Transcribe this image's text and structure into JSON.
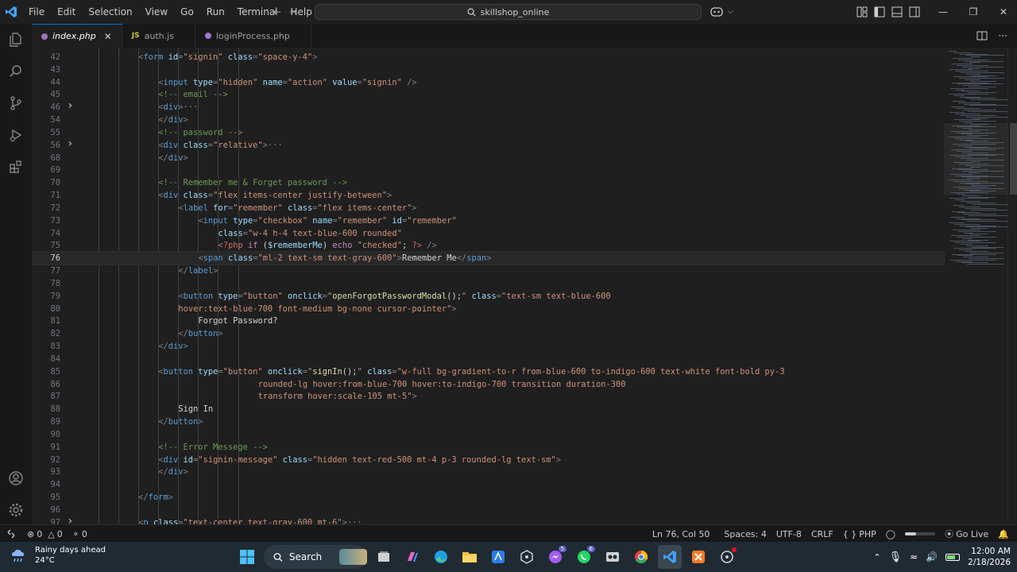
{
  "menu": [
    "File",
    "Edit",
    "Selection",
    "View",
    "Go",
    "Run",
    "Terminal",
    "Help"
  ],
  "search_box": "skillshop_online",
  "tabs": [
    {
      "label": "index.php",
      "icon": "php-icon",
      "active": true
    },
    {
      "label": "auth.js",
      "icon": "js-icon",
      "active": false
    },
    {
      "label": "loginProcess.php",
      "icon": "php-icon",
      "active": false
    }
  ],
  "tab_js_mark": "JS",
  "code_lines": [
    {
      "n": "42",
      "indent": 2,
      "tokens": [
        [
          "t",
          "<"
        ],
        [
          "n",
          "form"
        ],
        [
          "a",
          " id"
        ],
        [
          "t",
          "="
        ],
        [
          "s",
          "\"signin\""
        ],
        [
          "a",
          " class"
        ],
        [
          "t",
          "="
        ],
        [
          "s",
          "\"space-y-4\""
        ],
        [
          "t",
          ">"
        ]
      ]
    },
    {
      "n": "43",
      "indent": 0,
      "tokens": []
    },
    {
      "n": "44",
      "indent": 3,
      "tokens": [
        [
          "t",
          "<"
        ],
        [
          "n",
          "input"
        ],
        [
          "a",
          " type"
        ],
        [
          "t",
          "="
        ],
        [
          "s",
          "\"hidden\""
        ],
        [
          "a",
          " name"
        ],
        [
          "t",
          "="
        ],
        [
          "s",
          "\"action\""
        ],
        [
          "a",
          " value"
        ],
        [
          "t",
          "="
        ],
        [
          "s",
          "\"signin\""
        ],
        [
          "t",
          " />"
        ]
      ]
    },
    {
      "n": "45",
      "indent": 3,
      "tokens": [
        [
          "c",
          "<!-- email -->"
        ]
      ]
    },
    {
      "n": "46",
      "indent": 3,
      "fold": true,
      "tokens": [
        [
          "t",
          "<"
        ],
        [
          "n",
          "div"
        ],
        [
          "t",
          ">"
        ],
        [
          "e",
          "···"
        ]
      ]
    },
    {
      "n": "54",
      "indent": 3,
      "tokens": [
        [
          "t",
          "</"
        ],
        [
          "n",
          "div"
        ],
        [
          "t",
          ">"
        ]
      ]
    },
    {
      "n": "55",
      "indent": 3,
      "tokens": [
        [
          "c",
          "<!-- password -->"
        ]
      ]
    },
    {
      "n": "56",
      "indent": 3,
      "fold": true,
      "tokens": [
        [
          "t",
          "<"
        ],
        [
          "n",
          "div"
        ],
        [
          "a",
          " class"
        ],
        [
          "t",
          "="
        ],
        [
          "s",
          "\"relative\""
        ],
        [
          "t",
          ">"
        ],
        [
          "e",
          "···"
        ]
      ]
    },
    {
      "n": "68",
      "indent": 3,
      "tokens": [
        [
          "t",
          "</"
        ],
        [
          "n",
          "div"
        ],
        [
          "t",
          ">"
        ]
      ]
    },
    {
      "n": "69",
      "indent": 0,
      "tokens": []
    },
    {
      "n": "70",
      "indent": 3,
      "tokens": [
        [
          "c",
          "<!-- Remember me & Forget password -->"
        ]
      ]
    },
    {
      "n": "71",
      "indent": 3,
      "tokens": [
        [
          "t",
          "<"
        ],
        [
          "n",
          "div"
        ],
        [
          "a",
          " class"
        ],
        [
          "t",
          "="
        ],
        [
          "s",
          "\"flex items-center justify-between\""
        ],
        [
          "t",
          ">"
        ]
      ]
    },
    {
      "n": "72",
      "indent": 4,
      "tokens": [
        [
          "t",
          "<"
        ],
        [
          "n",
          "label"
        ],
        [
          "a",
          " for"
        ],
        [
          "t",
          "="
        ],
        [
          "s",
          "\"remember\""
        ],
        [
          "a",
          " class"
        ],
        [
          "t",
          "="
        ],
        [
          "s",
          "\"flex items-center\""
        ],
        [
          "t",
          ">"
        ]
      ]
    },
    {
      "n": "73",
      "indent": 5,
      "tokens": [
        [
          "t",
          "<"
        ],
        [
          "n",
          "input"
        ],
        [
          "a",
          " type"
        ],
        [
          "t",
          "="
        ],
        [
          "s",
          "\"checkbox\""
        ],
        [
          "a",
          " name"
        ],
        [
          "t",
          "="
        ],
        [
          "s",
          "\"remember\""
        ],
        [
          "a",
          " id"
        ],
        [
          "t",
          "="
        ],
        [
          "s",
          "\"remember\""
        ]
      ]
    },
    {
      "n": "74",
      "indent": 6,
      "tokens": [
        [
          "a",
          "class"
        ],
        [
          "t",
          "="
        ],
        [
          "s",
          "\"w-4 h-4 text-blue-600 rounded\""
        ]
      ]
    },
    {
      "n": "75",
      "indent": 6,
      "tokens": [
        [
          "p",
          "<?php"
        ],
        [
          "k",
          " if"
        ],
        [
          "x",
          " ("
        ],
        [
          "v",
          "$rememberMe"
        ],
        [
          "x",
          ") "
        ],
        [
          "k",
          "echo"
        ],
        [
          "s",
          " \"checked\""
        ],
        [
          "x",
          "; "
        ],
        [
          "p",
          "?>"
        ],
        [
          "t",
          " />"
        ]
      ]
    },
    {
      "n": "76",
      "indent": 5,
      "current": true,
      "tokens": [
        [
          "t",
          "<"
        ],
        [
          "n",
          "span"
        ],
        [
          "a",
          " class"
        ],
        [
          "t",
          "="
        ],
        [
          "s",
          "\"ml-2 text-sm text-gray-600\""
        ],
        [
          "t",
          ">"
        ],
        [
          "x",
          "Remember Me"
        ],
        [
          "t",
          "</"
        ],
        [
          "n",
          "span"
        ],
        [
          "t",
          ">"
        ]
      ]
    },
    {
      "n": "77",
      "indent": 4,
      "tokens": [
        [
          "t",
          "</"
        ],
        [
          "n",
          "label"
        ],
        [
          "t",
          ">"
        ]
      ]
    },
    {
      "n": "78",
      "indent": 0,
      "tokens": []
    },
    {
      "n": "79",
      "indent": 4,
      "tokens": [
        [
          "t",
          "<"
        ],
        [
          "n",
          "button"
        ],
        [
          "a",
          " type"
        ],
        [
          "t",
          "="
        ],
        [
          "s",
          "\"button\""
        ],
        [
          "a",
          " onclick"
        ],
        [
          "t",
          "="
        ],
        [
          "s",
          "\""
        ],
        [
          "f",
          "openForgotPasswordModal"
        ],
        [
          "x",
          "();"
        ],
        [
          "s",
          "\""
        ],
        [
          "a",
          " class"
        ],
        [
          "t",
          "="
        ],
        [
          "s",
          "\"text-sm text-blue-600"
        ]
      ]
    },
    {
      "n": "80",
      "indent": 4,
      "tokens": [
        [
          "s",
          "hover:text-blue-700 font-medium bg-none cursor-pointer\""
        ],
        [
          "t",
          ">"
        ]
      ]
    },
    {
      "n": "81",
      "indent": 5,
      "tokens": [
        [
          "x",
          "Forgot Password?"
        ]
      ]
    },
    {
      "n": "82",
      "indent": 4,
      "tokens": [
        [
          "t",
          "</"
        ],
        [
          "n",
          "button"
        ],
        [
          "t",
          ">"
        ]
      ]
    },
    {
      "n": "83",
      "indent": 3,
      "tokens": [
        [
          "t",
          "</"
        ],
        [
          "n",
          "div"
        ],
        [
          "t",
          ">"
        ]
      ]
    },
    {
      "n": "84",
      "indent": 0,
      "tokens": []
    },
    {
      "n": "85",
      "indent": 3,
      "tokens": [
        [
          "t",
          "<"
        ],
        [
          "n",
          "button"
        ],
        [
          "a",
          " type"
        ],
        [
          "t",
          "="
        ],
        [
          "s",
          "\"button\""
        ],
        [
          "a",
          " onclick"
        ],
        [
          "t",
          "="
        ],
        [
          "s",
          "\""
        ],
        [
          "f",
          "signIn"
        ],
        [
          "x",
          "();"
        ],
        [
          "s",
          "\""
        ],
        [
          "a",
          " class"
        ],
        [
          "t",
          "="
        ],
        [
          "s",
          "\"w-full bg-gradient-to-r from-blue-600 to-indigo-600 text-white font-bold py-3"
        ]
      ]
    },
    {
      "n": "86",
      "indent": 8,
      "tokens": [
        [
          "s",
          "rounded-lg hover:from-blue-700 hover:to-indigo-700 transition duration-300"
        ]
      ]
    },
    {
      "n": "87",
      "indent": 8,
      "tokens": [
        [
          "s",
          "transform hover:scale-105 mt-5\""
        ],
        [
          "t",
          ">"
        ]
      ]
    },
    {
      "n": "88",
      "indent": 4,
      "tokens": [
        [
          "x",
          "Sign In"
        ]
      ]
    },
    {
      "n": "89",
      "indent": 3,
      "tokens": [
        [
          "t",
          "</"
        ],
        [
          "n",
          "button"
        ],
        [
          "t",
          ">"
        ]
      ]
    },
    {
      "n": "90",
      "indent": 0,
      "tokens": []
    },
    {
      "n": "91",
      "indent": 3,
      "tokens": [
        [
          "c",
          "<!-- Error Messege -->"
        ]
      ]
    },
    {
      "n": "92",
      "indent": 3,
      "tokens": [
        [
          "t",
          "<"
        ],
        [
          "n",
          "div"
        ],
        [
          "a",
          " id"
        ],
        [
          "t",
          "="
        ],
        [
          "s",
          "\"signin-message\""
        ],
        [
          "a",
          " class"
        ],
        [
          "t",
          "="
        ],
        [
          "s",
          "\"hidden text-red-500 mt-4 p-3 rounded-lg text-sm\""
        ],
        [
          "t",
          ">"
        ]
      ]
    },
    {
      "n": "93",
      "indent": 3,
      "tokens": [
        [
          "t",
          "</"
        ],
        [
          "n",
          "div"
        ],
        [
          "t",
          ">"
        ]
      ]
    },
    {
      "n": "94",
      "indent": 0,
      "tokens": []
    },
    {
      "n": "95",
      "indent": 2,
      "tokens": [
        [
          "t",
          "</"
        ],
        [
          "n",
          "form"
        ],
        [
          "t",
          ">"
        ]
      ]
    },
    {
      "n": "96",
      "indent": 0,
      "tokens": []
    },
    {
      "n": "97",
      "indent": 2,
      "fold": true,
      "tokens": [
        [
          "t",
          "<"
        ],
        [
          "n",
          "p"
        ],
        [
          "a",
          " class"
        ],
        [
          "t",
          "="
        ],
        [
          "s",
          "\"text-center text-gray-600 mt-6\""
        ],
        [
          "t",
          ">"
        ],
        [
          "e",
          "···"
        ]
      ]
    }
  ],
  "status": {
    "errors": "0",
    "warnings": "0",
    "ports": "0",
    "position": "Ln 76, Col 50",
    "spaces": "Spaces: 4",
    "encoding": "UTF-8",
    "eol": "CRLF",
    "language": "PHP",
    "golive": "Go Live"
  },
  "taskbar": {
    "weather_title": "Rainy days ahead",
    "weather_temp": "24°C",
    "search_label": "Search",
    "time": "12:00 AM",
    "date": "2/18/2026",
    "badge_edge": "5",
    "badge_whatsapp": "6"
  }
}
